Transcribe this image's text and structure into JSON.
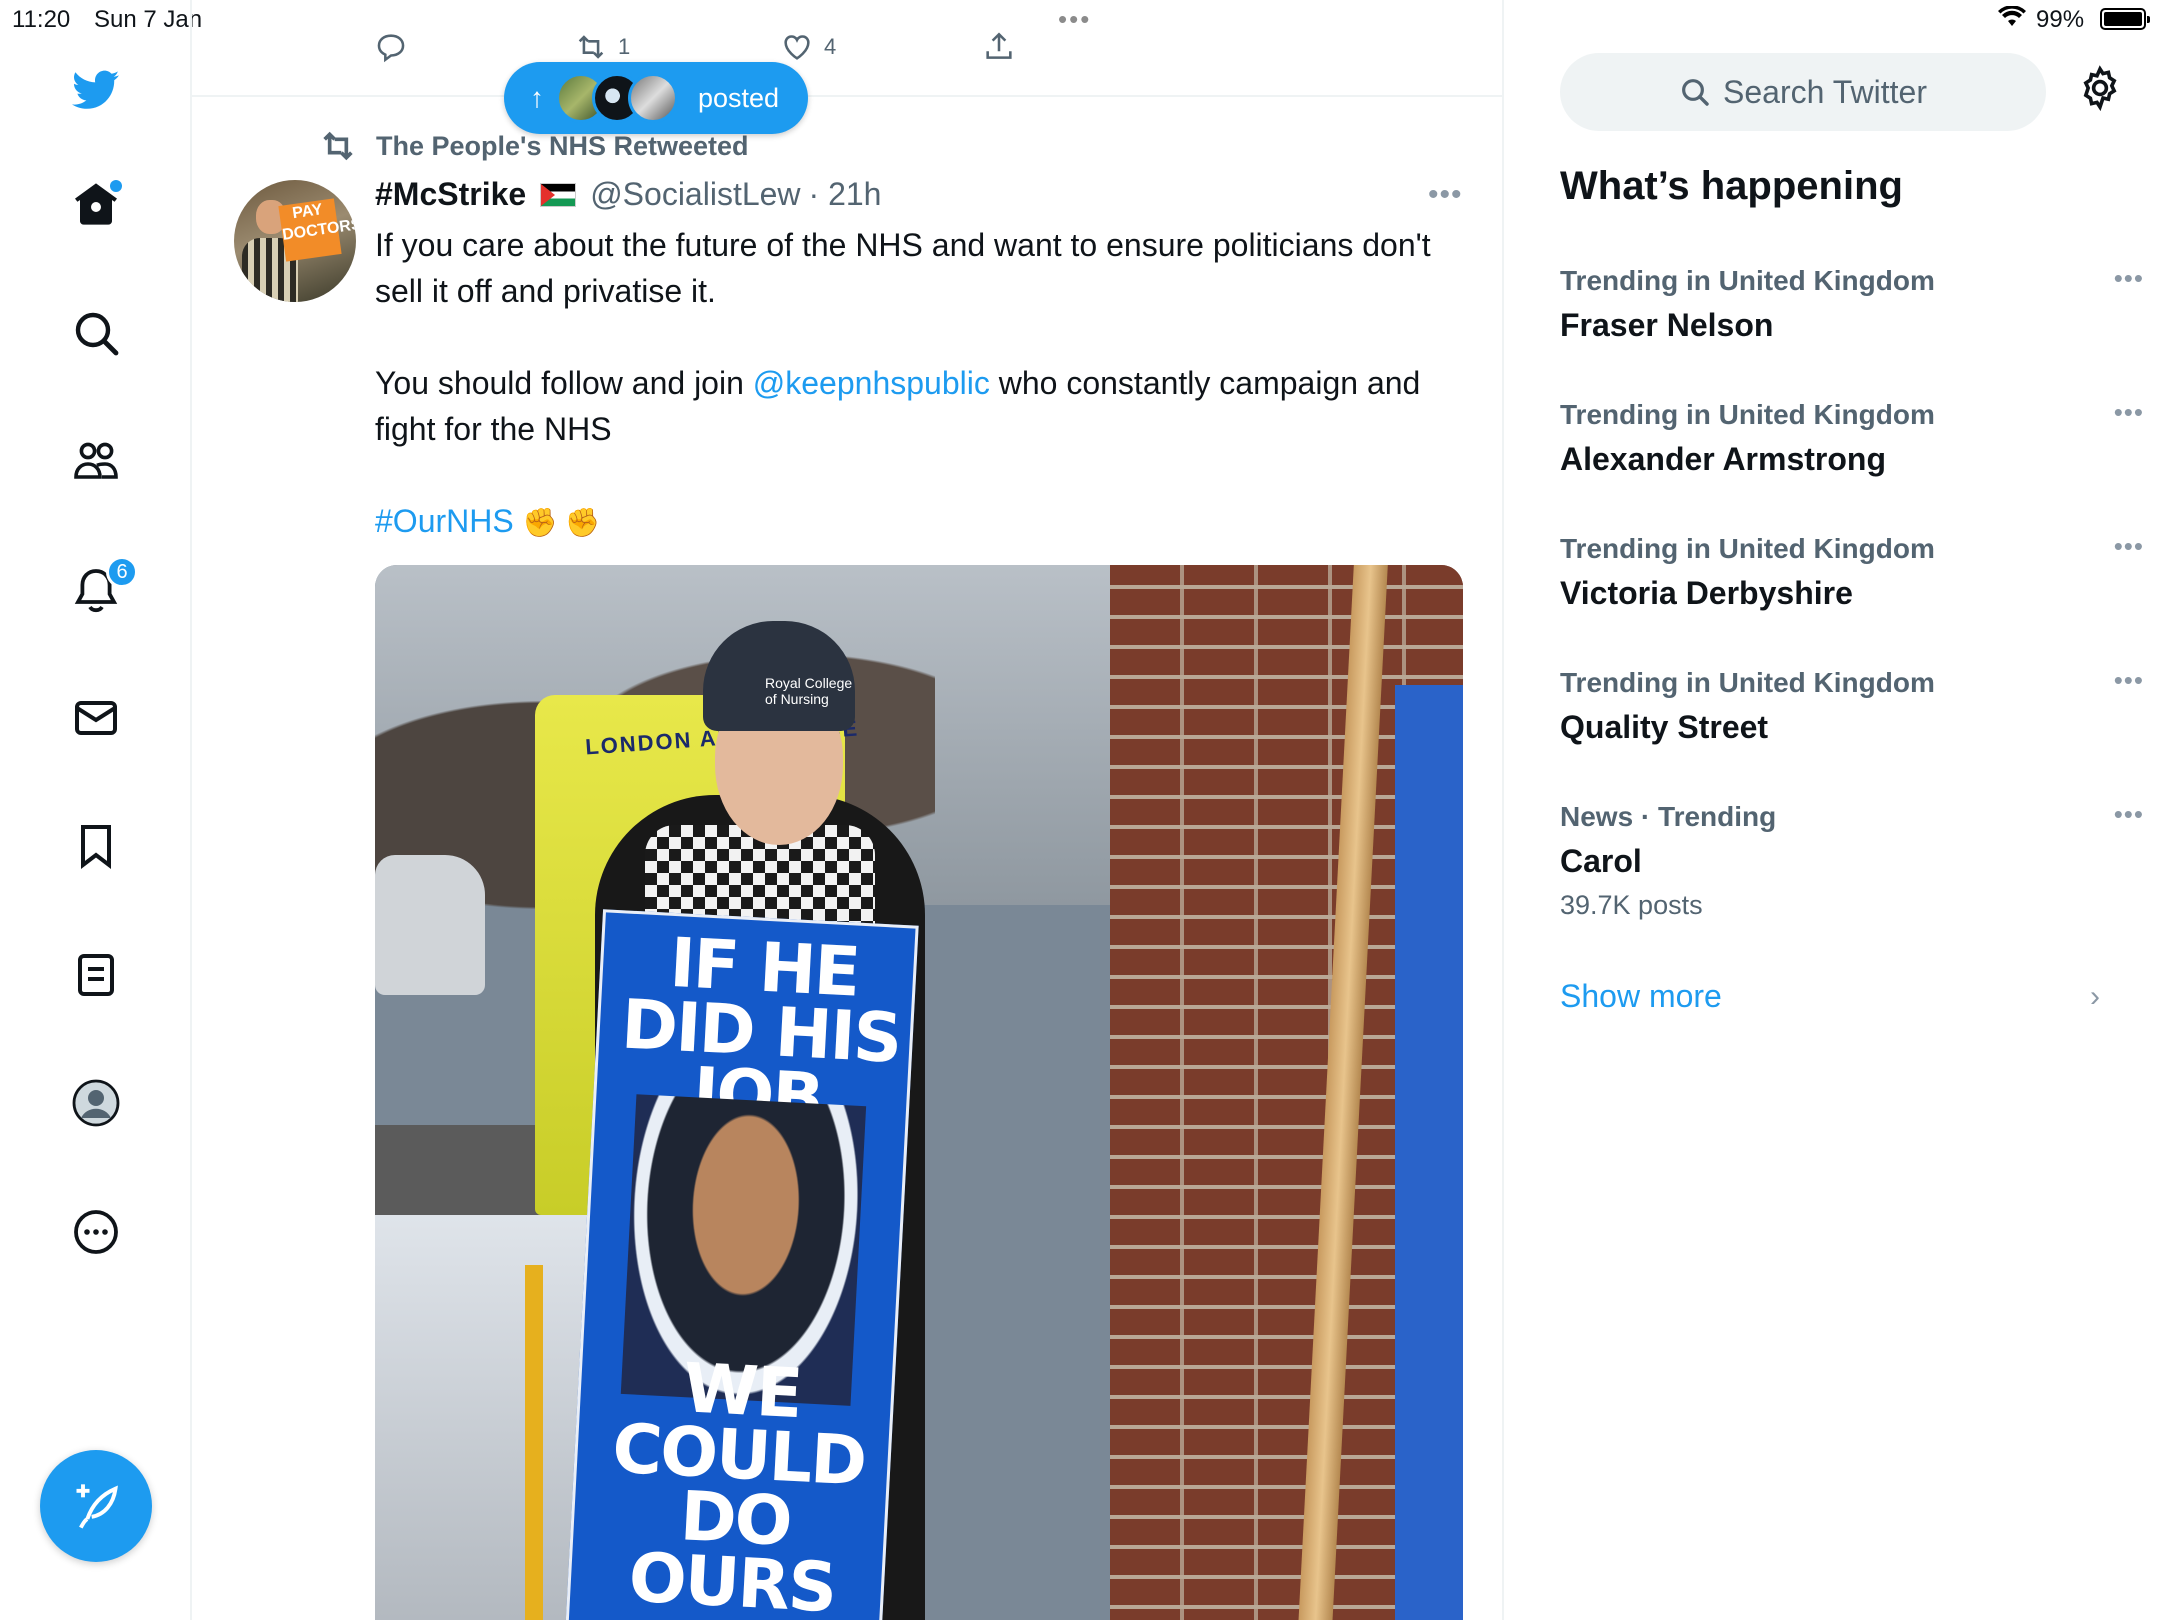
{
  "status_bar": {
    "time": "11:20",
    "date": "Sun 7 Jan",
    "battery": "99%",
    "multitask_dots": "•••"
  },
  "nav": {
    "items": [
      {
        "name": "twitter-logo-icon"
      },
      {
        "name": "home-icon"
      },
      {
        "name": "search-icon"
      },
      {
        "name": "communities-icon"
      },
      {
        "name": "notifications-icon"
      },
      {
        "name": "messages-icon"
      },
      {
        "name": "bookmarks-icon"
      },
      {
        "name": "lists-icon"
      },
      {
        "name": "profile-icon"
      },
      {
        "name": "more-icon"
      }
    ],
    "notifications_count": "6"
  },
  "previous_tweet": {
    "retweets": "1",
    "likes": "4"
  },
  "new_posts_pill": {
    "arrow": "↑",
    "label": "posted"
  },
  "tweet": {
    "retweeted_by": "The People's NHS Retweeted",
    "display_name": "#McStrike",
    "handle": "@SocialistLew",
    "time": "· 21h",
    "more": "•••",
    "body_line1": "If you care about the future of the NHS and want to ensure politicians don't sell it off and privatise it.",
    "body_line2_pre": "You should follow and join ",
    "body_mention": "@keepnhspublic",
    "body_line2_post": " who constantly campaign and fight for the NHS",
    "hashtag": "#OurNHS",
    "emojis": "✊ ✊",
    "image": {
      "placard_top": "IF HE DID HIS JOB",
      "placard_bottom": "WE COULD DO OURS",
      "ambulance_text": "LONDON AMBULANCE",
      "beanie_text": "Royal College of Nursing",
      "avatar_sign": "PAY DOCTORS"
    }
  },
  "sidebar": {
    "search_placeholder": "Search Twitter",
    "whats_happening": "What’s happening",
    "trends": [
      {
        "context": "Trending in United Kingdom",
        "title": "Fraser Nelson",
        "count": ""
      },
      {
        "context": "Trending in United Kingdom",
        "title": "Alexander Armstrong",
        "count": ""
      },
      {
        "context": "Trending in United Kingdom",
        "title": "Victoria Derbyshire",
        "count": ""
      },
      {
        "context": "Trending in United Kingdom",
        "title": "Quality Street",
        "count": ""
      },
      {
        "context": "News · Trending",
        "title": "Carol",
        "count": "39.7K posts"
      }
    ],
    "trend_more": "•••",
    "show_more": "Show more",
    "chevron": "›"
  },
  "colors": {
    "accent": "#1d9bf0",
    "text_primary": "#0f1419",
    "text_secondary": "#536471"
  }
}
